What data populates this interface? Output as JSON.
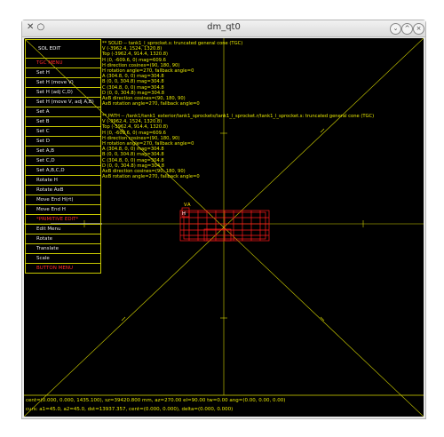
{
  "window": {
    "title": "dm_qt0",
    "left_glyph": "✕ ○",
    "buttons": [
      "⌄",
      "^",
      "×"
    ]
  },
  "colors": {
    "background": "#000000",
    "overlay": "#e8e800",
    "highlight": "#ff2a2a",
    "frame": "#c8c800"
  },
  "menu": {
    "items": [
      {
        "label": "SOL EDIT",
        "header": true,
        "color": "white"
      },
      {
        "label": "TGC MENU",
        "color": "red"
      },
      {
        "label": "Set H"
      },
      {
        "label": "Set H (move V)"
      },
      {
        "label": "Set H (adj C,D)"
      },
      {
        "label": "Set H (move V, adj A,B)"
      },
      {
        "label": "Set A"
      },
      {
        "label": "Set B"
      },
      {
        "label": "Set C"
      },
      {
        "label": "Set D"
      },
      {
        "label": "Set A,B"
      },
      {
        "label": "Set C,D"
      },
      {
        "label": "Set A,B,C,D"
      },
      {
        "label": "Rotate H"
      },
      {
        "label": "Rotate AxB"
      },
      {
        "label": "Move End H(rt)"
      },
      {
        "label": "Move End H"
      },
      {
        "label": "*PRIMITIVE EDIT*",
        "color": "red"
      },
      {
        "label": "Edit Menu"
      },
      {
        "label": "Rotate"
      },
      {
        "label": "Translate"
      },
      {
        "label": "Scale"
      },
      {
        "label": "BUTTON MENU",
        "color": "red"
      }
    ]
  },
  "solid_info": [
    "** SOLID -- tank1_l_sprocket.s: truncated general cone (TGC)",
    "V (-3962.4, 1524, 1320.8)",
    "Top (-3962.4, 914.4, 1320.8)",
    "H (0, -609.6, 0) mag=609.6",
    "H direction cosines=(90, 180, 90)",
    "H rotation angle=270, fallback angle=0",
    "A (304.8, 0, 0) mag=304.8",
    "B (0, 0, 304.8) mag=304.8",
    "C (304.8, 0, 0) mag=304.8",
    "D (0, 0, 304.8) mag=304.8",
    "AxB direction cosines=(90, 180, 90)",
    "AxB rotation angle=270, fallback angle=0"
  ],
  "path_info": [
    "** PATH -- /tank1/tank1_exterior/tank1_sprockets/tank1_l_sprocket.r/tank1_l_sprocket.s: truncated general cone (TGC)",
    "V (-3962.4, 1524, 1320.8)",
    "Top (-3962.4, 914.4, 1320.8)",
    "H (0, -609.6, 0) mag=609.6",
    "H direction cosines=(90, 180, 90)",
    "H rotation angle=270, fallback angle=0",
    "A (304.8, 0, 0) mag=304.8",
    "B (0, 0, 304.8) mag=304.8",
    "C (304.8, 0, 0) mag=304.8",
    "D (0, 0, 304.8) mag=304.8",
    "AxB direction cosines=(90, 180, 90)",
    "AxB rotation angle=270, fallback angle=0"
  ],
  "model_labels": {
    "v_label": "V",
    "a_label": "A",
    "h_label": "H"
  },
  "status": {
    "line1": "cent=(0.000, 0.000, 1435.100), sz=39420.800 mm, az=270.00 el=90.00 tw=0.00 ang=(0.00, 0.00, 0.00)",
    "line2": "curs:  a1=45.0,  a2=45.0,  dst=13937.357,  cent=(0.000, 0.000),  delta=(0.000, 0.000)"
  }
}
